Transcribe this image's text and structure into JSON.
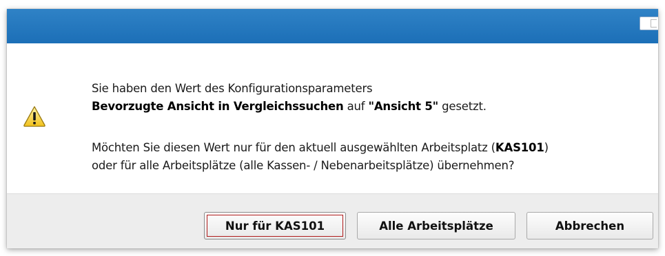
{
  "dialog": {
    "icon": "warning-icon",
    "message": {
      "line1": "Sie haben den Wert des Konfigurationsparameters",
      "param_name": "Bevorzugte Ansicht in Vergleichssuchen",
      "connector": " auf ",
      "param_value": "\"Ansicht 5\"",
      "suffix": " gesetzt.",
      "question_prefix": "Möchten Sie diesen Wert nur für den aktuell ausgewählten Arbeitsplatz (",
      "workstation": "KAS101",
      "question_suffix": ")",
      "line4": "oder für alle Arbeitsplätze (alle Kassen- / Nebenarbeitsplätze) übernehmen?"
    },
    "buttons": {
      "current_label": "Nur für KAS101",
      "all_label": "Alle Arbeitsplätze",
      "cancel_label": "Abbrechen"
    }
  },
  "colors": {
    "titlebar": "#2276bd",
    "footer": "#ededed",
    "focus": "#b01a1a",
    "warning_fill": "#f7d02c"
  }
}
